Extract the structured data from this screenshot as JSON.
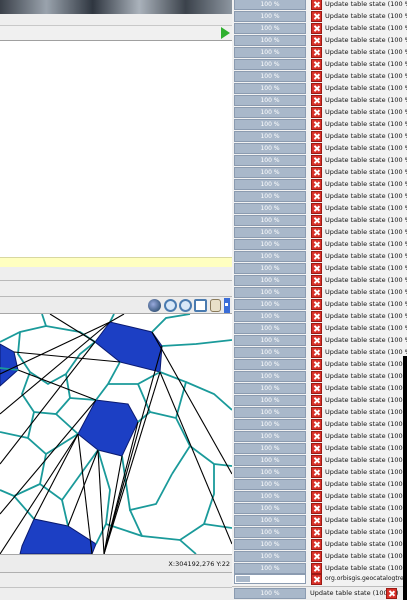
{
  "map": {
    "coordinates": "X:304192,276 Y:22"
  },
  "tasks": {
    "rows": [
      {
        "percent": "100 %",
        "label": "Update table state (100 %)",
        "progress": 1.0
      },
      {
        "percent": "100 %",
        "label": "Update table state (100 %)",
        "progress": 1.0
      },
      {
        "percent": "100 %",
        "label": "Update table state (100 %)",
        "progress": 1.0
      },
      {
        "percent": "100 %",
        "label": "Update table state (100 %)",
        "progress": 1.0
      },
      {
        "percent": "100 %",
        "label": "Update table state (100 %)",
        "progress": 1.0
      },
      {
        "percent": "100 %",
        "label": "Update table state (100 %)",
        "progress": 1.0
      },
      {
        "percent": "100 %",
        "label": "Update table state (100 %)",
        "progress": 1.0
      },
      {
        "percent": "100 %",
        "label": "Update table state (100 %)",
        "progress": 1.0
      },
      {
        "percent": "100 %",
        "label": "Update table state (100 %)",
        "progress": 1.0
      },
      {
        "percent": "100 %",
        "label": "Update table state (100 %)",
        "progress": 1.0
      },
      {
        "percent": "100 %",
        "label": "Update table state (100 %)",
        "progress": 1.0
      },
      {
        "percent": "100 %",
        "label": "Update table state (100 %)",
        "progress": 1.0
      },
      {
        "percent": "100 %",
        "label": "Update table state (100 %)",
        "progress": 1.0
      },
      {
        "percent": "100 %",
        "label": "Update table state (100 %)",
        "progress": 1.0
      },
      {
        "percent": "100 %",
        "label": "Update table state (100 %)",
        "progress": 1.0
      },
      {
        "percent": "100 %",
        "label": "Update table state (100 %)",
        "progress": 1.0
      },
      {
        "percent": "100 %",
        "label": "Update table state (100 %)",
        "progress": 1.0
      },
      {
        "percent": "100 %",
        "label": "Update table state (100 %)",
        "progress": 1.0
      },
      {
        "percent": "100 %",
        "label": "Update table state (100 %)",
        "progress": 1.0
      },
      {
        "percent": "100 %",
        "label": "Update table state (100 %)",
        "progress": 1.0
      },
      {
        "percent": "100 %",
        "label": "Update table state (100 %)",
        "progress": 1.0
      },
      {
        "percent": "100 %",
        "label": "Update table state (100 %)",
        "progress": 1.0
      },
      {
        "percent": "100 %",
        "label": "Update table state (100 %)",
        "progress": 1.0
      },
      {
        "percent": "100 %",
        "label": "Update table state (100 %)",
        "progress": 1.0
      },
      {
        "percent": "100 %",
        "label": "Update table state (100 %)",
        "progress": 1.0
      },
      {
        "percent": "100 %",
        "label": "Update table state (100 %)",
        "progress": 1.0
      },
      {
        "percent": "100 %",
        "label": "Update table state (100 %)",
        "progress": 1.0
      },
      {
        "percent": "100 %",
        "label": "Update table state (100 %)",
        "progress": 1.0
      },
      {
        "percent": "100 %",
        "label": "Update table state (100 %)",
        "progress": 1.0
      },
      {
        "percent": "100 %",
        "label": "Update table state (100 %)",
        "progress": 1.0
      },
      {
        "percent": "100 %",
        "label": "Update table state (100 %)",
        "progress": 1.0
      },
      {
        "percent": "100 %",
        "label": "Update table state (100 %)",
        "progress": 1.0
      },
      {
        "percent": "100 %",
        "label": "Update table state (100 %)",
        "progress": 1.0
      },
      {
        "percent": "100 %",
        "label": "Update table state (100 %)",
        "progress": 1.0
      },
      {
        "percent": "100 %",
        "label": "Update table state (100 %)",
        "progress": 1.0
      },
      {
        "percent": "100 %",
        "label": "Update table state (100 %)",
        "progress": 1.0
      },
      {
        "percent": "100 %",
        "label": "Update table state (100 %)",
        "progress": 1.0
      },
      {
        "percent": "100 %",
        "label": "Update table state (100 %)",
        "progress": 1.0
      },
      {
        "percent": "100 %",
        "label": "Update table state (100 %)",
        "progress": 1.0
      },
      {
        "percent": "100 %",
        "label": "Update table state (100 %)",
        "progress": 1.0
      },
      {
        "percent": "100 %",
        "label": "Update table state (100 %)",
        "progress": 1.0
      },
      {
        "percent": "100 %",
        "label": "Update table state (100 %)",
        "progress": 1.0
      },
      {
        "percent": "100 %",
        "label": "Update table state (100 %)",
        "progress": 1.0
      },
      {
        "percent": "100 %",
        "label": "Update table state (100 %)",
        "progress": 1.0
      },
      {
        "percent": "100 %",
        "label": "Update table state (100 %)",
        "progress": 1.0
      },
      {
        "percent": "100 %",
        "label": "Update table state (100 %)",
        "progress": 1.0
      },
      {
        "percent": "100 %",
        "label": "Update table state (100 %)",
        "progress": 1.0
      },
      {
        "percent": "100 %",
        "label": "Update table state (100 %)",
        "progress": 1.0
      }
    ],
    "loading_task": {
      "label": "org.orbisgis.geocatalogtree.",
      "progress": 0.2
    },
    "status": {
      "percent": "100 %",
      "label": "Update table state (100 %)"
    }
  },
  "colors": {
    "progress_fill": "#a9b8ca",
    "cancel_red": "#d83028",
    "polygon_fill": "#1c3fc4",
    "voronoi_teal": "#1a9a9a",
    "triangulation_black": "#000000",
    "highlight_yellow": "#ffffc0",
    "run_green": "#2fb02f"
  }
}
